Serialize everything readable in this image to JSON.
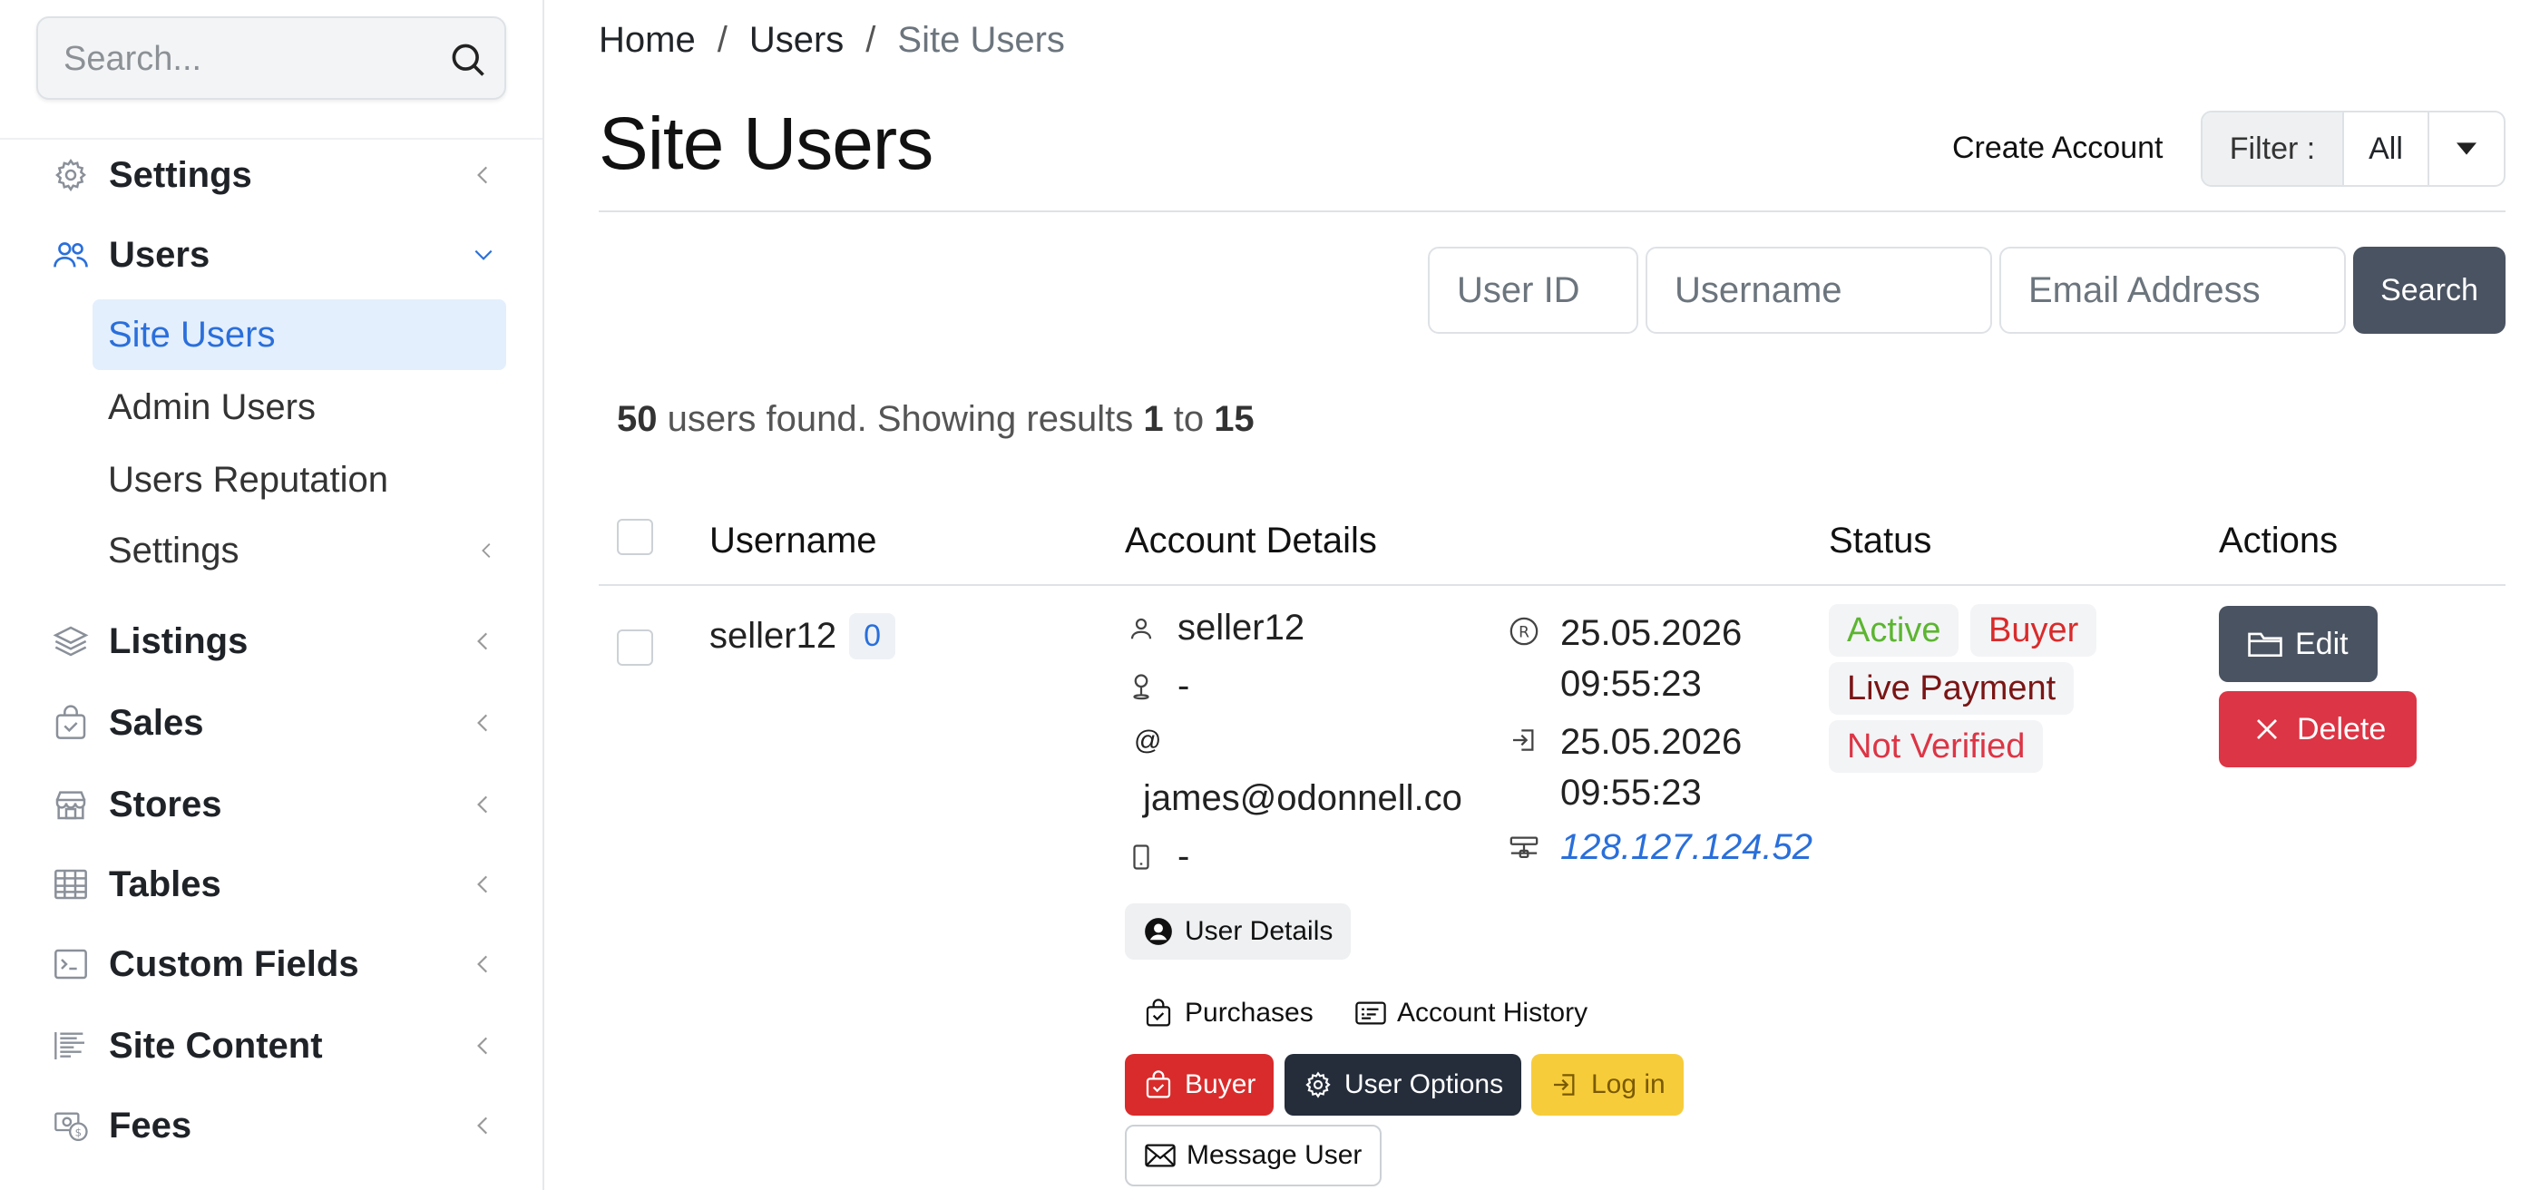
{
  "sidebar": {
    "search": {
      "placeholder": "Search..."
    },
    "items": [
      {
        "label": "Settings",
        "icon": "gear-icon"
      },
      {
        "label": "Users",
        "icon": "users-icon"
      },
      {
        "label": "Listings",
        "icon": "layers-icon"
      },
      {
        "label": "Sales",
        "icon": "shopping-bag-icon"
      },
      {
        "label": "Stores",
        "icon": "store-icon"
      },
      {
        "label": "Tables",
        "icon": "table-icon"
      },
      {
        "label": "Custom Fields",
        "icon": "terminal-icon"
      },
      {
        "label": "Site Content",
        "icon": "text-icon"
      },
      {
        "label": "Fees",
        "icon": "cash-icon"
      }
    ],
    "users_sub": [
      {
        "label": "Site Users",
        "active": true
      },
      {
        "label": "Admin Users"
      },
      {
        "label": "Users Reputation"
      },
      {
        "label": "Settings"
      }
    ]
  },
  "breadcrumb": {
    "home": "Home",
    "users": "Users",
    "current": "Site Users",
    "sep": "/"
  },
  "page": {
    "title": "Site Users"
  },
  "header": {
    "create_account": "Create Account",
    "filter_label": "Filter :",
    "filter_value": "All"
  },
  "search_form": {
    "user_id_placeholder": "User ID",
    "username_placeholder": "Username",
    "email_placeholder": "Email Address",
    "search_label": "Search"
  },
  "results": {
    "total": "50",
    "text1": " users found. Showing results ",
    "from": "1",
    "to_text": " to ",
    "to": "15"
  },
  "table": {
    "headers": [
      "Username",
      "Account Details",
      "Status",
      "Actions"
    ],
    "rows": [
      {
        "username": "seller12",
        "count": "0",
        "details": {
          "username": "seller12",
          "location": "-",
          "email_symbol": "@",
          "email": "james@odonnell.co",
          "phone": "-",
          "registered_date": "25.05.2026",
          "registered_time": "09:55:23",
          "last_login_date": "25.05.2026",
          "last_login_time": "09:55:23",
          "ip": "128.127.124.52"
        },
        "buttons": {
          "user_details": "User Details",
          "purchases": "Purchases",
          "account_history": "Account History",
          "buyer": "Buyer",
          "user_options": "User Options",
          "log_in": "Log in",
          "message_user": "Message User"
        },
        "status": {
          "active": "Active",
          "buyer": "Buyer",
          "live_payment": "Live Payment",
          "not_verified": "Not Verified"
        },
        "actions": {
          "edit": "Edit",
          "delete": "Delete"
        }
      }
    ]
  },
  "colors": {
    "accent": "#2a6fdb",
    "active_green": "#5cb531",
    "danger": "#dc3545",
    "buyer_red": "#d92b2b",
    "dark": "#252d3b",
    "warning": "#f7cc3b",
    "secondary": "#4a5361"
  }
}
